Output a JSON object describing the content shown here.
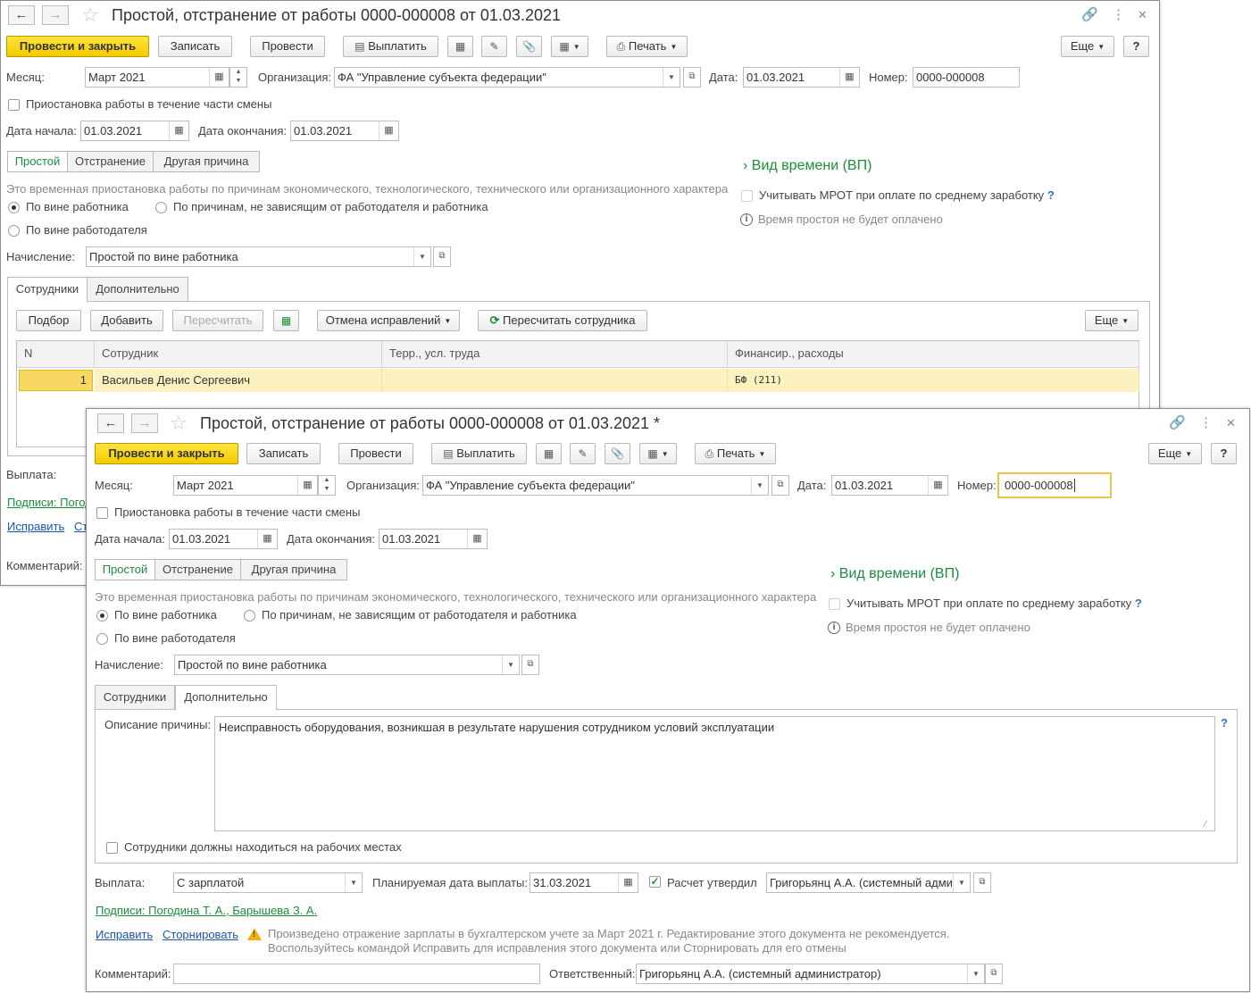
{
  "back": {
    "title": "Простой, отстранение от работы 0000-000008 от 01.03.2021",
    "toolbar": {
      "post_close": "Провести и закрыть",
      "save": "Записать",
      "post": "Провести",
      "pay": "Выплатить",
      "print": "Печать",
      "more": "Еще",
      "help": "?"
    },
    "month_label": "Месяц:",
    "month_value": "Март 2021",
    "org_label": "Организация:",
    "org_value": "ФА \"Управление субъекта федерации\"",
    "date_label": "Дата:",
    "date_value": "01.03.2021",
    "number_label": "Номер:",
    "number_value": "0000-000008",
    "partial_shift": "Приостановка работы в течение части смены",
    "start_label": "Дата начала:",
    "start_value": "01.03.2021",
    "end_label": "Дата окончания:",
    "end_value": "01.03.2021",
    "seg": [
      "Простой",
      "Отстранение",
      "Другая причина"
    ],
    "worktime_link": "Вид времени (ВП)",
    "description": "Это временная приостановка работы по причинам экономического, технологического, технического или организационного характера",
    "mrot": "Учитывать МРОТ при оплате по среднему заработку",
    "not_paid": "Время простоя не будет оплачено",
    "radio1": "По вине работника",
    "radio2": "По причинам, не зависящим от работодателя и работника",
    "radio3": "По вине работодателя",
    "accrual_label": "Начисление:",
    "accrual_value": "Простой по вине работника",
    "tabs": [
      "Сотрудники",
      "Дополнительно"
    ],
    "grid_toolbar": {
      "pick": "Подбор",
      "add": "Добавить",
      "recalc": "Пересчитать",
      "cancel_fix": "Отмена исправлений",
      "recalc_emp": "Пересчитать сотрудника",
      "more": "Еще"
    },
    "columns": [
      "N",
      "Сотрудник",
      "Терр., усл. труда",
      "Финансир., расходы"
    ],
    "row": {
      "n": "1",
      "employee": "Васильев Денис Сергеевич",
      "terr": "",
      "fin": "БФ (211)"
    },
    "payment_label": "Выплата:",
    "signatures_link": "Подписи: Погоди",
    "fix_link": "Исправить",
    "storno_link": "Ст",
    "comment_label": "Комментарий:"
  },
  "front": {
    "title": "Простой, отстранение от работы 0000-000008 от 01.03.2021 *",
    "toolbar": {
      "post_close": "Провести и закрыть",
      "save": "Записать",
      "post": "Провести",
      "pay": "Выплатить",
      "print": "Печать",
      "more": "Еще",
      "help": "?"
    },
    "month_label": "Месяц:",
    "month_value": "Март 2021",
    "org_label": "Организация:",
    "org_value": "ФА \"Управление субъекта федерации\"",
    "date_label": "Дата:",
    "date_value": "01.03.2021",
    "number_label": "Номер:",
    "number_value": "0000-000008",
    "partial_shift": "Приостановка работы в течение части смены",
    "start_label": "Дата начала:",
    "start_value": "01.03.2021",
    "end_label": "Дата окончания:",
    "end_value": "01.03.2021",
    "seg": [
      "Простой",
      "Отстранение",
      "Другая причина"
    ],
    "worktime_link": "Вид времени (ВП)",
    "description": "Это временная приостановка работы по причинам экономического, технологического, технического или организационного характера",
    "mrot": "Учитывать МРОТ при оплате по среднему заработку",
    "not_paid": "Время простоя не будет оплачено",
    "radio1": "По вине работника",
    "radio2": "По причинам, не зависящим от работодателя и работника",
    "radio3": "По вине работодателя",
    "accrual_label": "Начисление:",
    "accrual_value": "Простой по вине работника",
    "tabs": [
      "Сотрудники",
      "Дополнительно"
    ],
    "reason_label": "Описание причины:",
    "reason_value": "Неисправность оборудования, возникшая в результате нарушения сотрудником условий эксплуатации",
    "at_workplace": "Сотрудники должны находиться на рабочих местах",
    "payment_label": "Выплата:",
    "payment_value": "С зарплатой",
    "plan_date_label": "Планируемая дата выплаты:",
    "plan_date_value": "31.03.2021",
    "approved_label": "Расчет утвердил",
    "approved_value": "Григорьянц А.А. (системный адми",
    "signatures_link": "Подписи: Погодина Т. А., Барышева З. А.",
    "fix_link": "Исправить",
    "storno_link": "Сторнировать",
    "warning_line1": "Произведено отражение зарплаты в бухгалтерском учете за Март 2021 г. Редактирование этого документа не рекомендуется.",
    "warning_line2": "Воспользуйтесь командой Исправить для исправления этого документа или Сторнировать для его отмены",
    "comment_label": "Комментарий:",
    "comment_value": "",
    "responsible_label": "Ответственный:",
    "responsible_value": "Григорьянц А.А. (системный администратор)"
  },
  "colors": {
    "accent_yellow": "#f4cb00",
    "green": "#1a8f3a",
    "link_blue": "#1b55b3",
    "row_highlight": "#fbf1c1"
  }
}
